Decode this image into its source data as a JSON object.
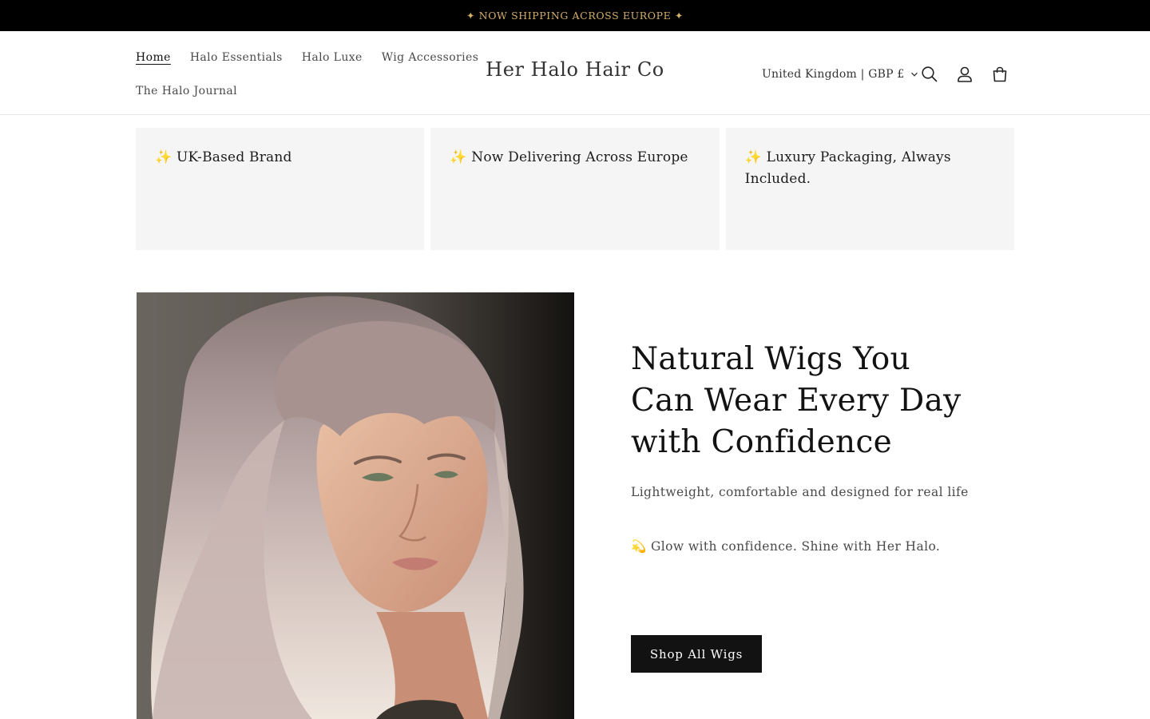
{
  "announcement": {
    "text": "✦ NOW SHIPPING ACROSS EUROPE ✦"
  },
  "header": {
    "nav": [
      {
        "label": "Home",
        "active": true
      },
      {
        "label": "Halo Essentials"
      },
      {
        "label": "Halo Luxe"
      },
      {
        "label": "Wig Accessories"
      },
      {
        "label": "The Halo Journal"
      }
    ],
    "logo": "Her Halo Hair Co",
    "country_selector": "United Kingdom | GBP £",
    "icons": [
      "search-icon",
      "account-icon",
      "cart-icon"
    ]
  },
  "usps": [
    {
      "text": "✨ UK-Based Brand"
    },
    {
      "text": "✨ Now Delivering Across Europe"
    },
    {
      "text": "✨ Luxury Packaging, Always Included."
    }
  ],
  "hero": {
    "title": "Natural Wigs You Can Wear Every Day with Confidence",
    "subtitle": "Lightweight, comfortable and designed for real life",
    "tagline": "💫 Glow with confidence. Shine with Her Halo.",
    "cta_label": "Shop All Wigs"
  },
  "colors": {
    "announcement_bg": "#000000",
    "announcement_text": "#d4af6a",
    "usp_bg": "#f5f5f5",
    "button_bg": "#121212",
    "button_text": "#ffffff"
  }
}
